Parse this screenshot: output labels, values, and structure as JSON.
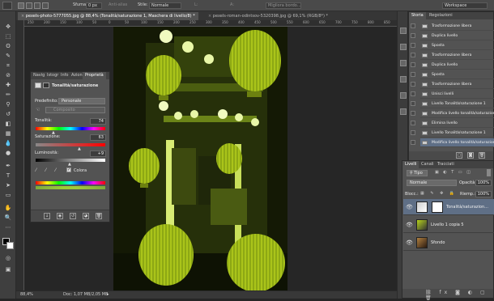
{
  "options_bar": {
    "sfuma_label": "Sfuma:",
    "sfuma_value": "0 px",
    "antialias_label": "Anti-alias",
    "stile_label": "Stile:",
    "stile_value": "Normale",
    "l_label": "L:",
    "a_label": "A:",
    "refine_button": "Migliora bordo...",
    "workspace": "Workspace"
  },
  "tabs": [
    {
      "label": "pexels-photo-5777055.jpg @ 88,4% (Tonalità/saturazione 1, Maschera di livello/8) *"
    },
    {
      "label": "pexels-roman-odintsov-5320398.jpg @ 69,1% (RGB/8*) *"
    }
  ],
  "ruler_top": [
    "250",
    "200",
    "150",
    "100",
    "50",
    "0",
    "50",
    "100",
    "150",
    "200",
    "250",
    "300",
    "350",
    "400",
    "450",
    "500",
    "550",
    "600",
    "650",
    "700",
    "750",
    "800",
    "850"
  ],
  "status": {
    "zoom": "88,4%",
    "doc": "Doc: 1,07 MB/2,05 MB"
  },
  "properties_panel": {
    "tabs": [
      "Navig",
      "Istogr",
      "Info",
      "Azion",
      "Proprietà"
    ],
    "title": "Tonalità/saturazione",
    "preset_label": "Predefinito:",
    "preset_value": "Personale",
    "channel_value": "Composito",
    "hue_label": "Tonalità:",
    "hue_value": "74",
    "sat_label": "Saturazione:",
    "sat_value": "63",
    "light_label": "Luminosità:",
    "light_value": "+9",
    "colorize_label": "Colora",
    "colorize_checked": true
  },
  "history_panel": {
    "tabs": [
      "Storia",
      "Regolazioni"
    ],
    "items": [
      {
        "label": "Trasformazione libera",
        "selected": false
      },
      {
        "label": "Duplica livello",
        "selected": false
      },
      {
        "label": "Sposta",
        "selected": false
      },
      {
        "label": "Trasformazione libera",
        "selected": false
      },
      {
        "label": "Duplica livello",
        "selected": false
      },
      {
        "label": "Sposta",
        "selected": false
      },
      {
        "label": "Trasformazione libera",
        "selected": false
      },
      {
        "label": "Unisci livelli",
        "selected": false
      },
      {
        "label": "Livello Tonalità/saturazione 1",
        "selected": false
      },
      {
        "label": "Modifica livello tonalità/saturazione",
        "selected": false
      },
      {
        "label": "Elimina livello",
        "selected": false
      },
      {
        "label": "Livello Tonalità/saturazione 1",
        "selected": false
      },
      {
        "label": "Modifica livello tonalità/saturazione",
        "selected": true
      }
    ]
  },
  "layers_panel": {
    "tabs": [
      "Livelli",
      "Canali",
      "Tracciati"
    ],
    "filter_value": "Tipo",
    "blend_value": "Normale",
    "opacity_label": "Opacità:",
    "opacity_value": "100%",
    "lock_label": "Blocc.:",
    "fill_label": "Riemp.:",
    "fill_value": "100%",
    "layers": [
      {
        "name": "Tonalità/saturazion...",
        "selected": true
      },
      {
        "name": "Livello 1 copia 5",
        "selected": false
      },
      {
        "name": "Sfondo",
        "selected": false
      }
    ]
  },
  "colors": {
    "accent_selection": "#5f6f86",
    "tint": "#b7d41c"
  }
}
